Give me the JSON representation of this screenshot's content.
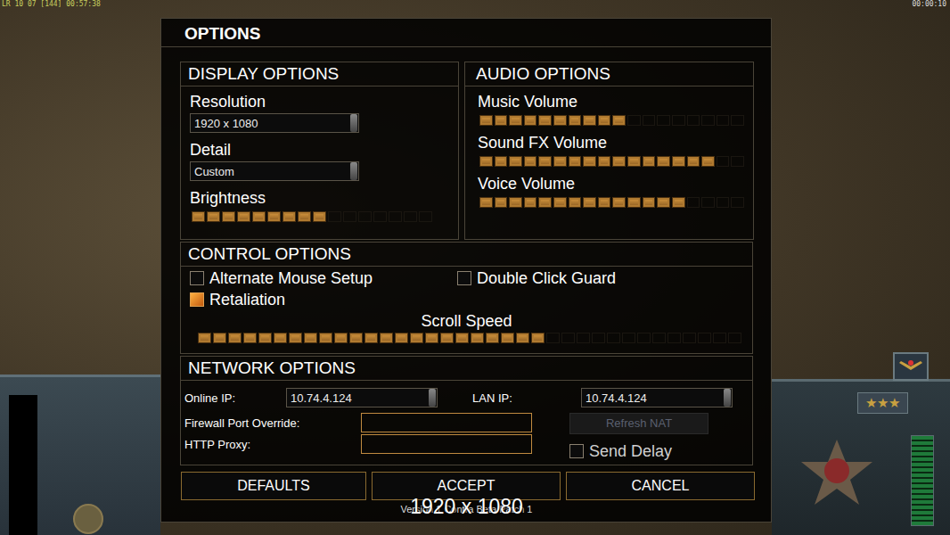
{
  "hud": {
    "top_left": "LR 10 07 [144] 00:57:38",
    "clock": "00:00:10",
    "rank": "★★★"
  },
  "dialog": {
    "title": "OPTIONS",
    "display": {
      "title": "DISPLAY OPTIONS",
      "dropdowns": [
        {
          "label": "Resolution",
          "value": "1920 x 1080"
        },
        {
          "label": "Detail",
          "value": "Custom"
        }
      ],
      "brightness": {
        "label": "Brightness",
        "level": 0.56
      }
    },
    "audio": {
      "title": "AUDIO OPTIONS",
      "sliders": [
        {
          "label": "Music Volume",
          "level": 0.56
        },
        {
          "label": "Sound FX Volume",
          "level": 0.89
        },
        {
          "label": "Voice Volume",
          "level": 0.78
        }
      ]
    },
    "control": {
      "title": "CONTROL OPTIONS",
      "checkboxes": [
        {
          "label": "Alternate Mouse Setup",
          "checked": false
        },
        {
          "label": "Double Click Guard",
          "checked": false
        },
        {
          "label": "Retaliation",
          "checked": true
        }
      ],
      "scroll": {
        "label": "Scroll Speed",
        "level": 0.64
      }
    },
    "network": {
      "title": "NETWORK OPTIONS",
      "ips": [
        {
          "label": "Online IP:",
          "value": "10.74.4.124"
        },
        {
          "label": "LAN IP:",
          "value": "10.74.4.124"
        }
      ],
      "fields": [
        {
          "label": "Firewall Port Override:",
          "value": ""
        },
        {
          "label": "HTTP Proxy:",
          "value": ""
        }
      ],
      "refresh": {
        "label": "Refresh NAT",
        "disabled": true
      },
      "send_delay": {
        "label": "Send Delay",
        "checked": false
      }
    },
    "buttons": [
      "DEFAULTS",
      "ACCEPT",
      "CANCEL"
    ],
    "version": "Version 1 Contra Beta Patch 1",
    "overlay": "1920 x 1080"
  }
}
